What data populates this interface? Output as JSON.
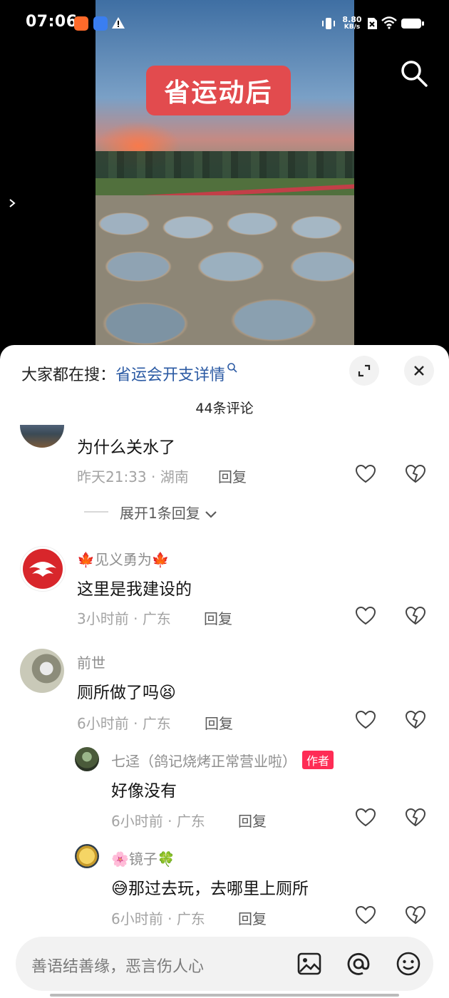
{
  "status_bar": {
    "time": "07:06",
    "net_speed_value": "8.80",
    "net_speed_unit": "KB/s"
  },
  "video": {
    "overlay_text": "省运动后"
  },
  "sheet": {
    "search_hint_prefix": "大家都在搜：",
    "search_hint_link": "省运会开支详情",
    "comment_count": "44条评论"
  },
  "comments": [
    {
      "text": "为什么关水了",
      "time": "昨天21:33",
      "region": "湖南",
      "reply_label": "回复",
      "expand_label": "展开1条回复"
    },
    {
      "user": "🍁见义勇为🍁",
      "text": "这里是我建设的",
      "time": "3小时前",
      "region": "广东",
      "reply_label": "回复"
    },
    {
      "user": "前世",
      "text": "厕所做了吗😫",
      "time": "6小时前",
      "region": "广东",
      "reply_label": "回复"
    },
    {
      "user": "七迳（鸽记烧烤正常营业啦）",
      "author_tag": "作者",
      "text": "好像没有",
      "time": "6小时前",
      "region": "广东",
      "reply_label": "回复"
    },
    {
      "user": "🌸镜子🍀",
      "text": "😅那过去玩，去哪里上厕所",
      "time": "6小时前",
      "region": "广东",
      "reply_label": "回复"
    }
  ],
  "input": {
    "placeholder": "善语结善缘，恶言伤人心"
  },
  "colors": {
    "link": "#2b5aa3",
    "author_tag": "#fe2c55",
    "overlay_badge": "#e24b4e"
  }
}
